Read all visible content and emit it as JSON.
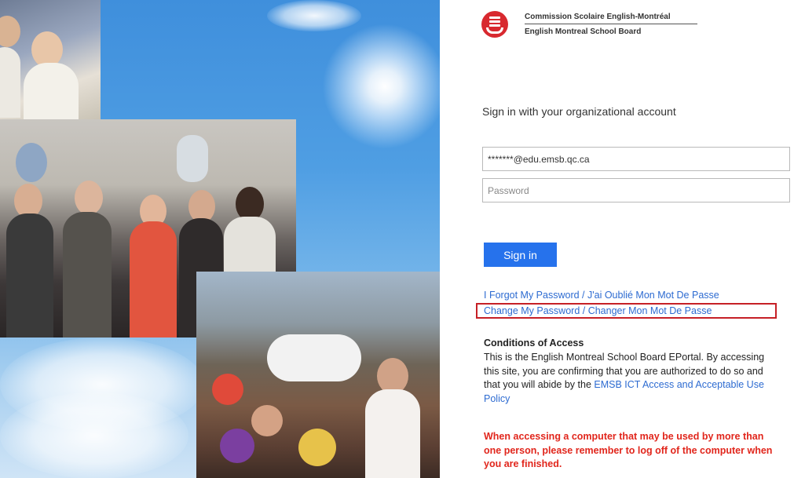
{
  "org": {
    "name_fr": "Commission Scolaire English-Montréal",
    "name_en": "English Montreal School Board",
    "brand_color": "#d8292f"
  },
  "login": {
    "heading": "Sign in with your organizational account",
    "username_value": "*******@edu.emsb.qc.ca",
    "password_placeholder": "Password",
    "signin_label": "Sign in",
    "signin_color": "#2672ec"
  },
  "links": {
    "forgot": "I Forgot My Password / J'ai Oublié Mon Mot De Passe",
    "change": "Change My Password / Changer Mon Mot De Passe",
    "link_color": "#2d6bd1"
  },
  "conditions": {
    "title": "Conditions of Access",
    "text": "This is the English Montreal School Board EPortal. By accessing this site, you are confirming that you are authorized to do so and that you will abide by the ",
    "policy_link": "EMSB ICT Access and Acceptable Use Policy"
  },
  "warning": {
    "text": "When accessing a computer that may be used by more than one person, please remember to log off of the computer when you are finished.",
    "color": "#e1261c"
  }
}
